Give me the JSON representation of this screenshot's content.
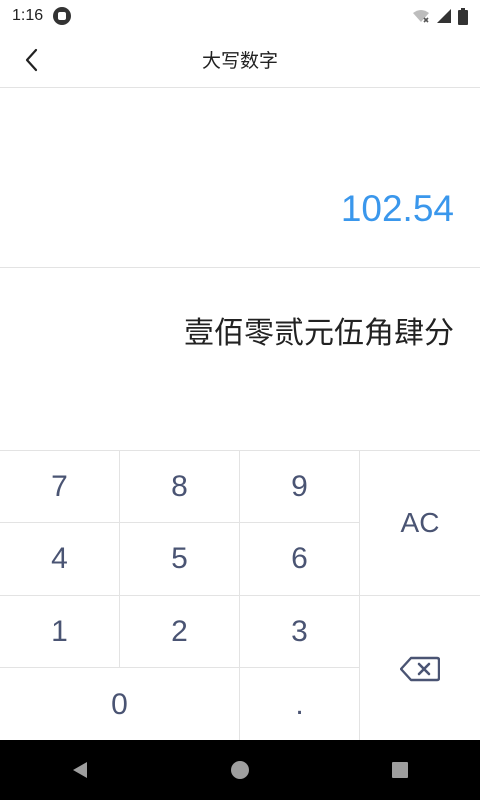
{
  "status_bar": {
    "time": "1:16",
    "icons": [
      "app-notification-icon",
      "wifi-off-icon",
      "signal-icon",
      "battery-icon"
    ]
  },
  "header": {
    "title": "大写数字",
    "back_icon": "chevron-left-icon"
  },
  "display": {
    "input_value": "102.54",
    "result_text": "壹佰零贰元伍角肆分"
  },
  "keypad": {
    "key_1": "1",
    "key_2": "2",
    "key_3": "3",
    "key_4": "4",
    "key_5": "5",
    "key_6": "6",
    "key_7": "7",
    "key_8": "8",
    "key_9": "9",
    "key_0": "0",
    "key_dot": ".",
    "key_ac": "AC",
    "backspace_icon": "backspace-icon"
  },
  "nav_bar": {
    "icons": [
      "back-triangle-icon",
      "home-circle-icon",
      "recents-square-icon"
    ]
  },
  "colors": {
    "accent": "#3a97ec",
    "key_text": "#4a5473",
    "divider": "#e3e3e3"
  }
}
